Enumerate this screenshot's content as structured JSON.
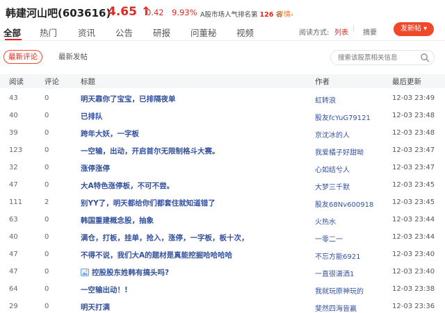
{
  "header": {
    "title": "韩建河山吧(603616)",
    "price": "4.65 ↑",
    "change": "0.42",
    "change_pct": "9.93%",
    "rank_prefix": "A股市场人气排名第",
    "rank_value": "126",
    "rank_suffix": "名",
    "detail_link": "详情›"
  },
  "tabs": [
    {
      "label": "全部",
      "active": true
    },
    {
      "label": "热门",
      "active": false
    },
    {
      "label": "资讯",
      "active": false
    },
    {
      "label": "公告",
      "active": false
    },
    {
      "label": "研报",
      "active": false
    },
    {
      "label": "问董秘",
      "active": false
    },
    {
      "label": "视频",
      "active": false
    }
  ],
  "read_mode": {
    "label": "阅读方式:",
    "list": "列表",
    "summary": "摘要"
  },
  "post_button": "发新帖 ▾",
  "sort": {
    "newest_comments": "最新评论",
    "newest_posts": "最新发帖"
  },
  "search": {
    "placeholder": "搜索该股票相关信息"
  },
  "table": {
    "headers": {
      "reads": "阅读",
      "comments": "评论",
      "title": "标题",
      "author": "作者",
      "updated": "最后更新"
    },
    "rows": [
      {
        "reads": "43",
        "comments": "0",
        "title": "明天靠你了宝宝，已排隔夜单",
        "author": "虹转浪",
        "updated": "12-03 23:49"
      },
      {
        "reads": "40",
        "comments": "0",
        "title": "已排队",
        "author": "股友fcYuG79121",
        "updated": "12-03 23:48"
      },
      {
        "reads": "39",
        "comments": "0",
        "title": "跨年大妖，一字板",
        "author": "京沈冰的人",
        "updated": "12-03 23:48"
      },
      {
        "reads": "123",
        "comments": "0",
        "title": "一空输，出动，开启首尔无限制格斗大赛。",
        "author": "我爱橘子好甜呦",
        "updated": "12-03 23:47"
      },
      {
        "reads": "32",
        "comments": "0",
        "title": "涨停涨停",
        "author": "心如结兮人",
        "updated": "12-03 23:47"
      },
      {
        "reads": "47",
        "comments": "0",
        "title": "大A特色涨停板，不可不尝。",
        "author": "大梦三千默",
        "updated": "12-03 23:45"
      },
      {
        "reads": "111",
        "comments": "2",
        "title": "别YY了，明天都给你们都套住就知道错了",
        "author": "股友68Nv600918",
        "updated": "12-03 23:45"
      },
      {
        "reads": "63",
        "comments": "0",
        "title": "韩国重建概念股，抽象",
        "author": "火热水",
        "updated": "12-03 23:44"
      },
      {
        "reads": "40",
        "comments": "0",
        "title": "满仓，打板，挂单，抢入，涨停，一字板，板十次，",
        "author": "一零二一",
        "updated": "12-03 23:44"
      },
      {
        "reads": "47",
        "comments": "0",
        "title": "不得不说，我们大A的题材是真能挖掘哈哈哈哈",
        "author": "不忘方能6921",
        "updated": "12-03 23:40"
      },
      {
        "reads": "47",
        "comments": "0",
        "title": "控股股东姓韩有搞头吗?",
        "author": "一直很潇洒1",
        "updated": "12-03 23:40",
        "has_image": true
      },
      {
        "reads": "64",
        "comments": "0",
        "title": "一空输出动！!",
        "author": "我就玩原神玩的",
        "updated": "12-03 23:38"
      },
      {
        "reads": "29",
        "comments": "0",
        "title": "明天打满",
        "author": "斐然四海皆赢",
        "updated": "12-03 23:36"
      }
    ]
  },
  "colors": {
    "accent": "#e0281e",
    "link": "#33519f",
    "header_bg": "#f5f6f8"
  }
}
